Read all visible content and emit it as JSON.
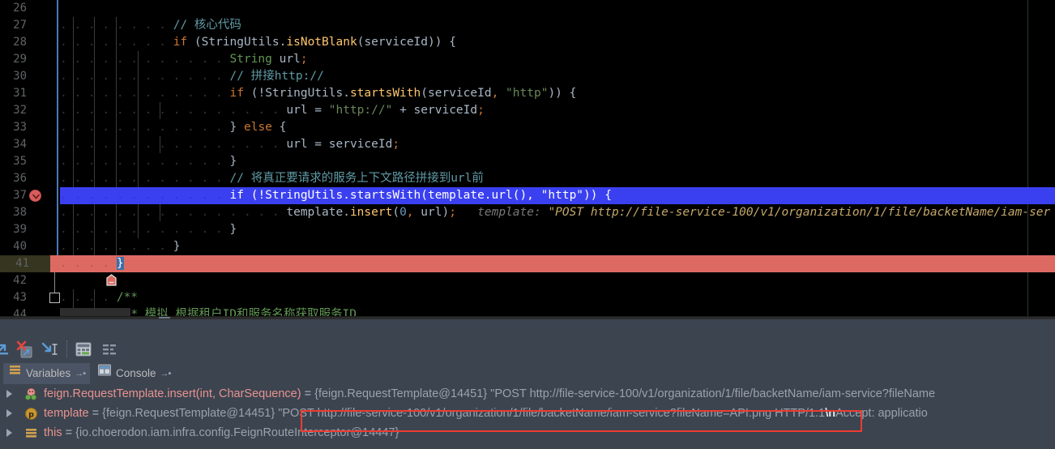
{
  "editor": {
    "language": "java",
    "right_margin_column": true,
    "lines": [
      {
        "num": "26",
        "text": "",
        "type": "plain"
      },
      {
        "num": "27",
        "text": "        // 核心代码",
        "type": "comment_cn"
      },
      {
        "num": "28",
        "text": "        if (StringUtils.isNotBlank(serviceId)) {",
        "type": "code"
      },
      {
        "num": "29",
        "text": "            String url;",
        "type": "code"
      },
      {
        "num": "30",
        "text": "            // 拼接http://",
        "type": "comment_cn"
      },
      {
        "num": "31",
        "text": "            if (!StringUtils.startsWith(serviceId, \"http\")) {",
        "type": "code"
      },
      {
        "num": "32",
        "text": "                url = \"http://\" + serviceId;",
        "type": "code"
      },
      {
        "num": "33",
        "text": "            } else {",
        "type": "code"
      },
      {
        "num": "34",
        "text": "                url = serviceId;",
        "type": "code"
      },
      {
        "num": "35",
        "text": "            }",
        "type": "code"
      },
      {
        "num": "36",
        "text": "            // 将真正要请求的服务上下文路径拼接到url前",
        "type": "comment_cn"
      },
      {
        "num": "37",
        "text": "            if (!StringUtils.startsWith(template.url(), \"http\")) {",
        "type": "code",
        "highlight": "execution",
        "breakpoint": true
      },
      {
        "num": "38",
        "text": "                template.insert(0, url);",
        "type": "code",
        "inline_hint": "template:",
        "inline_hint_value": "\"POST http://file-service-100/v1/organization/1/file/backetName/iam-ser"
      },
      {
        "num": "39",
        "text": "            }",
        "type": "code"
      },
      {
        "num": "40",
        "text": "        }",
        "type": "code"
      },
      {
        "num": "41",
        "text": "    }",
        "type": "code",
        "highlight": "error",
        "current_line": true,
        "fold": "collapse"
      },
      {
        "num": "42",
        "text": "",
        "type": "plain"
      },
      {
        "num": "43",
        "text": "    /**",
        "type": "comment",
        "fold": "minus"
      },
      {
        "num": "44",
        "text": "     * 模拟 根据租户ID和服务名称获取服务ID",
        "type": "comment"
      }
    ]
  },
  "debug_panel": {
    "toolbar_icons": [
      "step-out-icon",
      "stop-breakpoint-icon",
      "run-to-cursor-icon",
      "evaluate-expression-icon",
      "sort-variables-icon"
    ],
    "tabs": [
      {
        "label": "Variables",
        "icon": "variables-icon",
        "active": true,
        "pin": "→▪"
      },
      {
        "label": "Console",
        "icon": "console-icon",
        "active": false,
        "pin": "→▪"
      }
    ],
    "variables": [
      {
        "icon": "method-frame-icon",
        "name": "feign.RequestTemplate.insert(int, CharSequence)",
        "equals": " = ",
        "value": "{feign.RequestTemplate@14451} \"POST http://file-service-100/v1/organization/1/file/backetName/iam-service?fileName",
        "expandable": true
      },
      {
        "icon": "parameter-icon",
        "name": "template",
        "equals": " = ",
        "value": "{feign.RequestTemplate@14451} \"POST http://file-service-100/v1/organization/1/file/backetName/iam-service?fileName=API.png HTTP/1.1",
        "value_escape": "\\n",
        "value_tail": "Accept: applicatio",
        "expandable": true,
        "annotated": true
      },
      {
        "icon": "this-object-icon",
        "name": "this",
        "equals": " = ",
        "value": "{io.choerodon.iam.infra.config.FeignRouteInterceptor@14447}",
        "expandable": true
      }
    ],
    "annotation": {
      "type": "red-rectangle",
      "color": "#ee3b30"
    }
  },
  "colors": {
    "editor_background": "#000000",
    "execution_highlight": "#3a40f0",
    "error_highlight": "#dd6a62",
    "panel_background": "#3c4450",
    "keyword": "#cc7832",
    "string": "#6a8759",
    "comment": "#629755",
    "comment_cn": "#5f9aa5",
    "method": "#ffc66d",
    "number": "#6897bb",
    "default_text": "#a9b7c6",
    "line_number": "#606366",
    "annotation_red": "#ee3b30"
  }
}
